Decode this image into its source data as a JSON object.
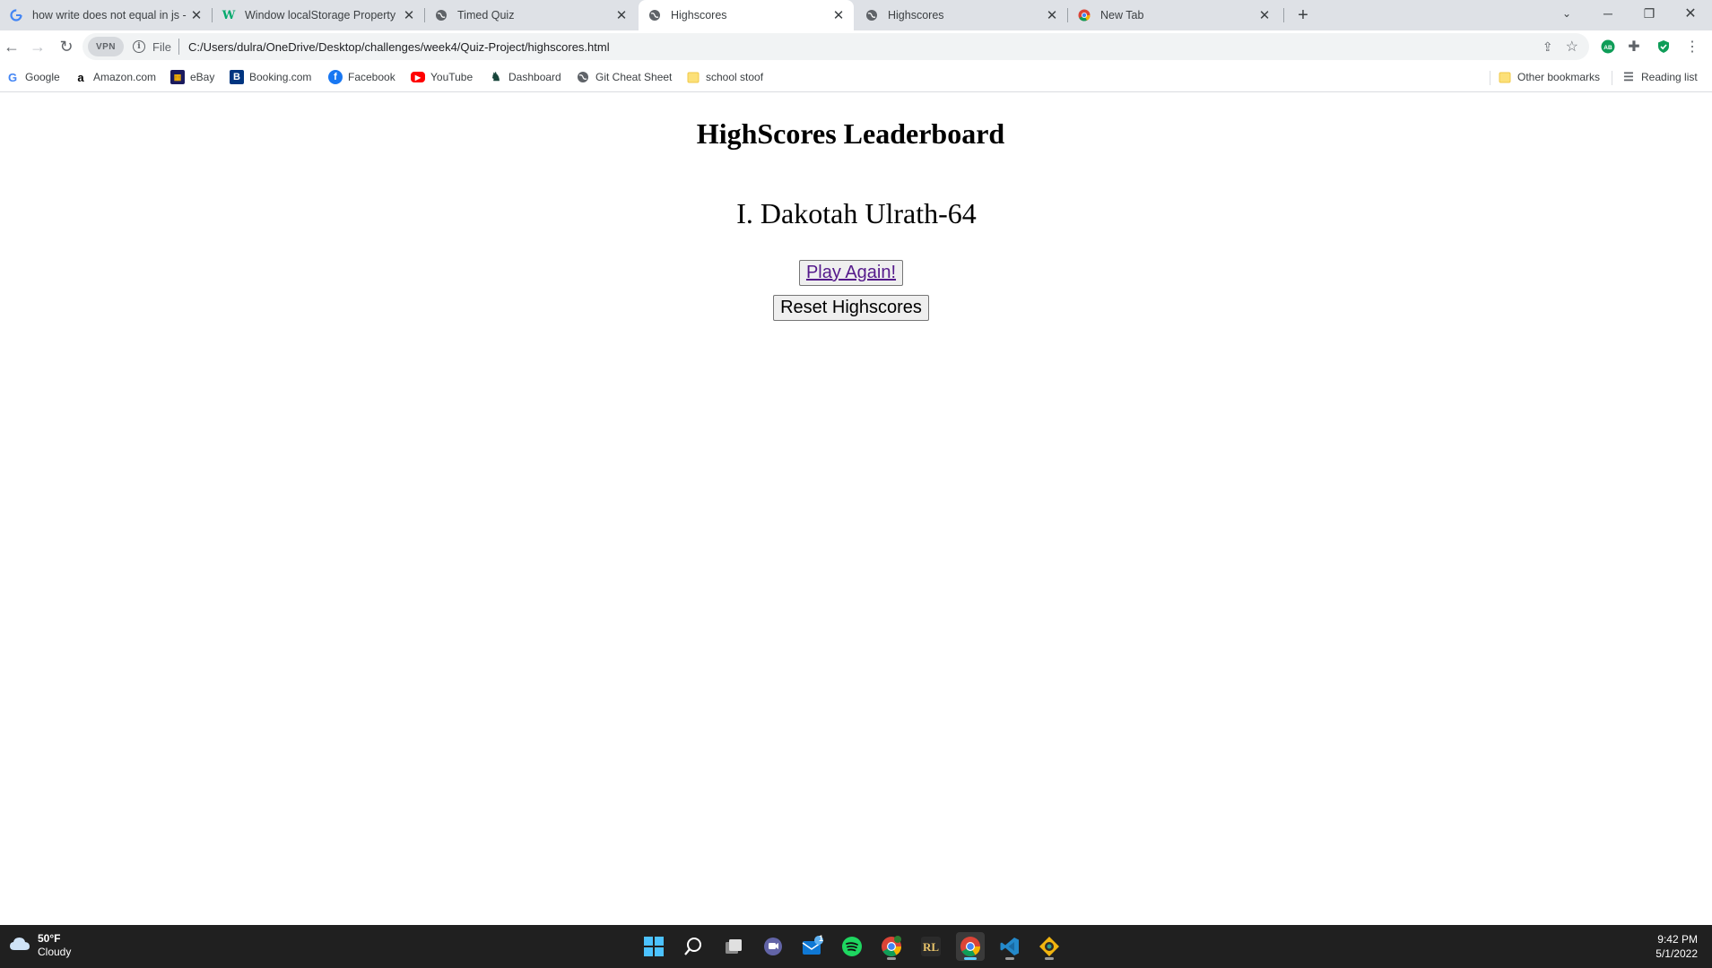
{
  "browser": {
    "tabs": [
      {
        "title": "how write does not equal in js - G",
        "favicon": "google-icon",
        "active": false
      },
      {
        "title": "Window localStorage Property",
        "favicon": "w3schools-icon",
        "active": false
      },
      {
        "title": "Timed Quiz",
        "favicon": "globe-icon",
        "active": false
      },
      {
        "title": "Highscores",
        "favicon": "globe-icon",
        "active": true
      },
      {
        "title": "Highscores",
        "favicon": "globe-icon",
        "active": false
      },
      {
        "title": "New Tab",
        "favicon": "chrome-icon",
        "active": false
      }
    ],
    "vpn_label": "VPN",
    "file_label": "File",
    "url": "C:/Users/dulra/OneDrive/Desktop/challenges/week4/Quiz-Project/highscores.html",
    "bookmarks": [
      {
        "label": "Google",
        "icon": "google-icon"
      },
      {
        "label": "Amazon.com",
        "icon": "amazon-icon"
      },
      {
        "label": "eBay",
        "icon": "ebay-icon"
      },
      {
        "label": "Booking.com",
        "icon": "booking-icon"
      },
      {
        "label": "Facebook",
        "icon": "facebook-icon"
      },
      {
        "label": "YouTube",
        "icon": "youtube-icon"
      },
      {
        "label": "Dashboard",
        "icon": "dashboard-icon"
      },
      {
        "label": "Git Cheat Sheet",
        "icon": "globe-icon"
      },
      {
        "label": "school stoof",
        "icon": "folder-icon"
      }
    ],
    "other_bookmarks": "Other bookmarks",
    "reading_list": "Reading list"
  },
  "page": {
    "heading": "HighScores Leaderboard",
    "scores": [
      "Dakotah Ulrath-64"
    ],
    "score_numeral": "I.",
    "play_again": "Play Again!",
    "reset": "Reset Highscores"
  },
  "taskbar": {
    "temperature": "50°F",
    "condition": "Cloudy",
    "time": "9:42 PM",
    "date": "5/1/2022",
    "mail_badge": "1"
  },
  "colors": {
    "tabstrip": "#dee1e6",
    "link_visited": "#551a8b",
    "taskbar": "#202020"
  }
}
